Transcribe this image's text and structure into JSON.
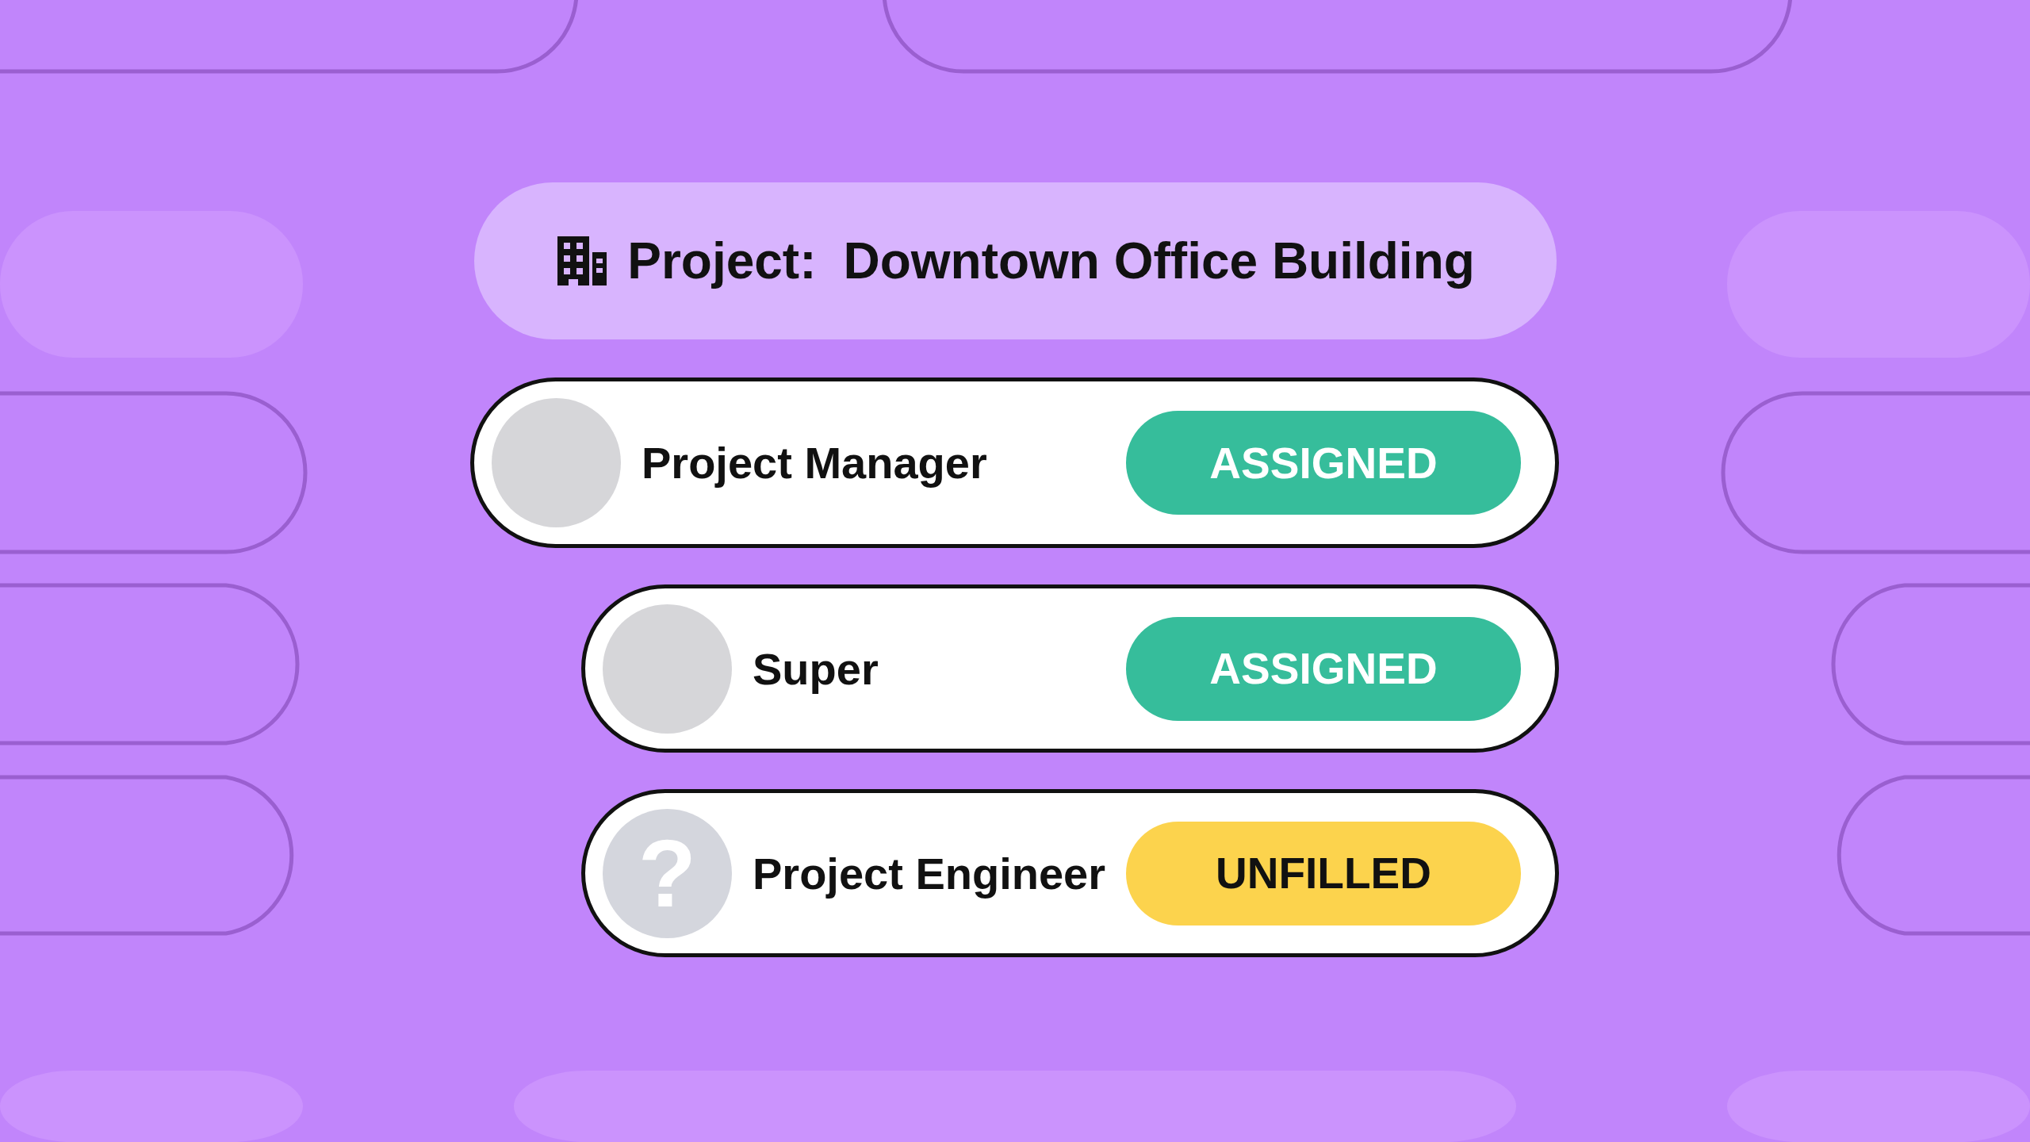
{
  "header": {
    "label": "Project:",
    "title": "Downtown Office Building"
  },
  "roles": [
    {
      "name": "Project Manager",
      "status": "ASSIGNED",
      "kind": "assigned",
      "avatar": {
        "kind": "photo"
      },
      "children": [
        {
          "name": "Super",
          "status": "ASSIGNED",
          "kind": "assigned",
          "avatar": {
            "kind": "photo"
          }
        },
        {
          "name": "Project Engineer",
          "status": "UNFILLED",
          "kind": "unfilled",
          "avatar": {
            "kind": "unknown",
            "symbol": "?"
          }
        }
      ]
    }
  ]
}
